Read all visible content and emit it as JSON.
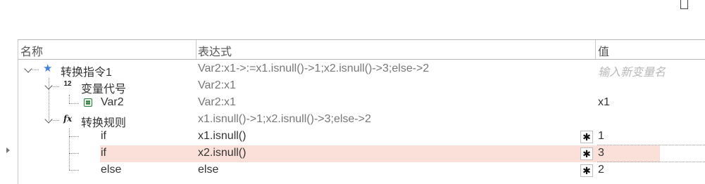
{
  "header": {
    "col_name": "名称",
    "col_expr": "表达式",
    "col_value": "值"
  },
  "rows": [
    {
      "name": "转换指令1",
      "expr": "Var2:x1->:=x1.isnull()->1;x2.isnull()->3;else->2",
      "value": "输入新变量名",
      "icon": "star-icon",
      "expanded": true
    },
    {
      "name": "变量代号",
      "expr": "Var2:x1",
      "value": "",
      "icon": "numeric-12-icon",
      "expanded": true
    },
    {
      "name": "Var2",
      "expr": "Var2:x1",
      "value": "x1",
      "icon": "variable-icon"
    },
    {
      "name": "转换规则",
      "expr": "x1.isnull()->1;x2.isnull()->3;else->2",
      "value": "",
      "icon": "fx-icon",
      "expanded": true
    },
    {
      "name": "if",
      "expr": "x1.isnull()",
      "value": "1",
      "icon": "gear-icon"
    },
    {
      "name": "if",
      "expr": "x2.isnull()",
      "value": "3",
      "icon": "gear-icon",
      "selected": true
    },
    {
      "name": "else",
      "expr": "else",
      "value": "2",
      "icon": "gear-icon"
    }
  ],
  "colors": {
    "selected_row": "#fbe0da",
    "star": "#3f7fd8",
    "variable": "#2f7d3d"
  }
}
